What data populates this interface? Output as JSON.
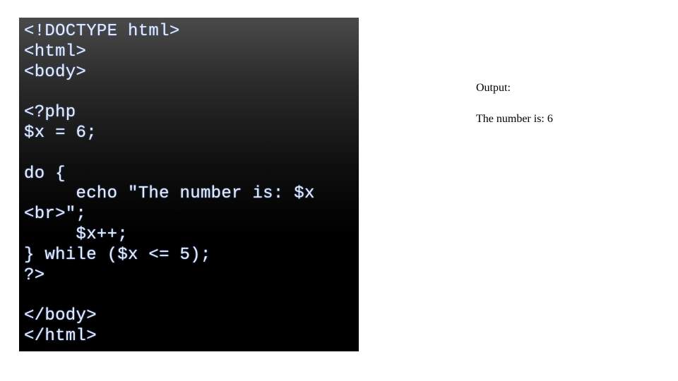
{
  "code_panel": {
    "language": "php",
    "lines": [
      "<!DOCTYPE html>",
      "<html>",
      "<body>",
      "",
      "<?php",
      "$x = 6;",
      "",
      "do {",
      "     echo \"The number is: $x",
      "<br>\";",
      "     $x++;",
      "} while ($x <= 5);",
      "?>",
      "",
      "</body>",
      "</html>"
    ]
  },
  "output_panel": {
    "label": "Output:",
    "value": "The number is: 6"
  }
}
